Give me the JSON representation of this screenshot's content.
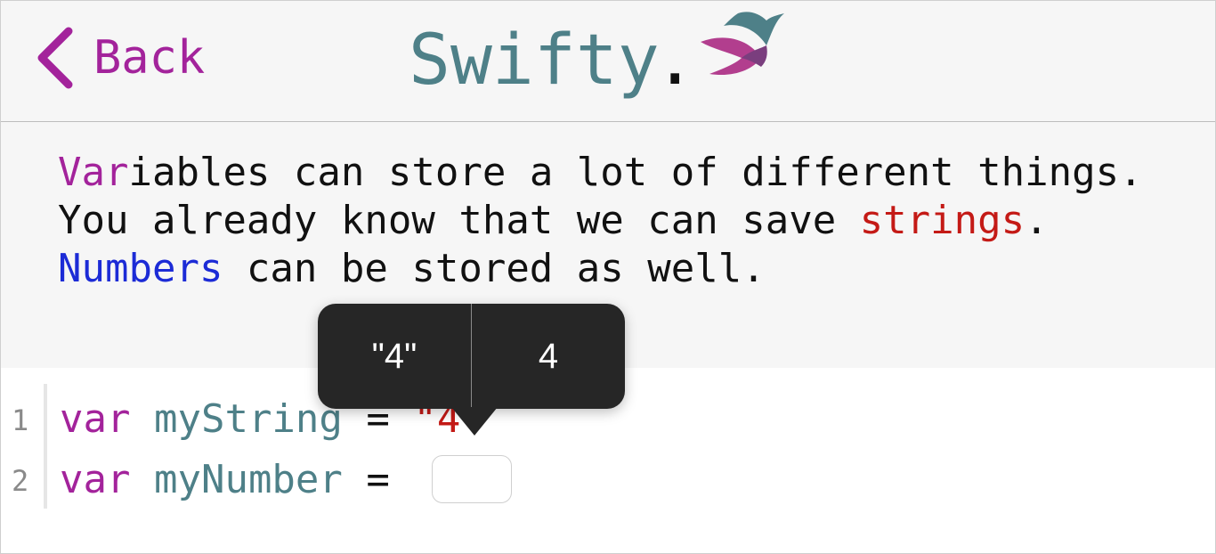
{
  "header": {
    "back_label": "Back",
    "logo_text": "Swifty",
    "logo_dot": "."
  },
  "description": {
    "line1_keyword": "Var",
    "line1_rest": "iables can store a lot of different things.",
    "line2_prefix": "You already know that we can save ",
    "line2_keyword": "strings",
    "line2_suffix": ".",
    "line3_keyword": "Numbers",
    "line3_rest": " can be stored as well."
  },
  "code": {
    "lines": [
      {
        "number": "1",
        "keyword": "var",
        "identifier": "myString",
        "operator": "=",
        "value": "\"4\""
      },
      {
        "number": "2",
        "keyword": "var",
        "identifier": "myNumber",
        "operator": "="
      }
    ]
  },
  "popover": {
    "options": [
      "\"4\"",
      "4"
    ]
  },
  "colors": {
    "keyword": "#a3239b",
    "identifier": "#4e8088",
    "string": "#c41a16",
    "number": "#1c2bd6",
    "popover_bg": "#262626"
  },
  "icons": {
    "back": "chevron-left-icon",
    "logo": "swift-bird-icon"
  }
}
